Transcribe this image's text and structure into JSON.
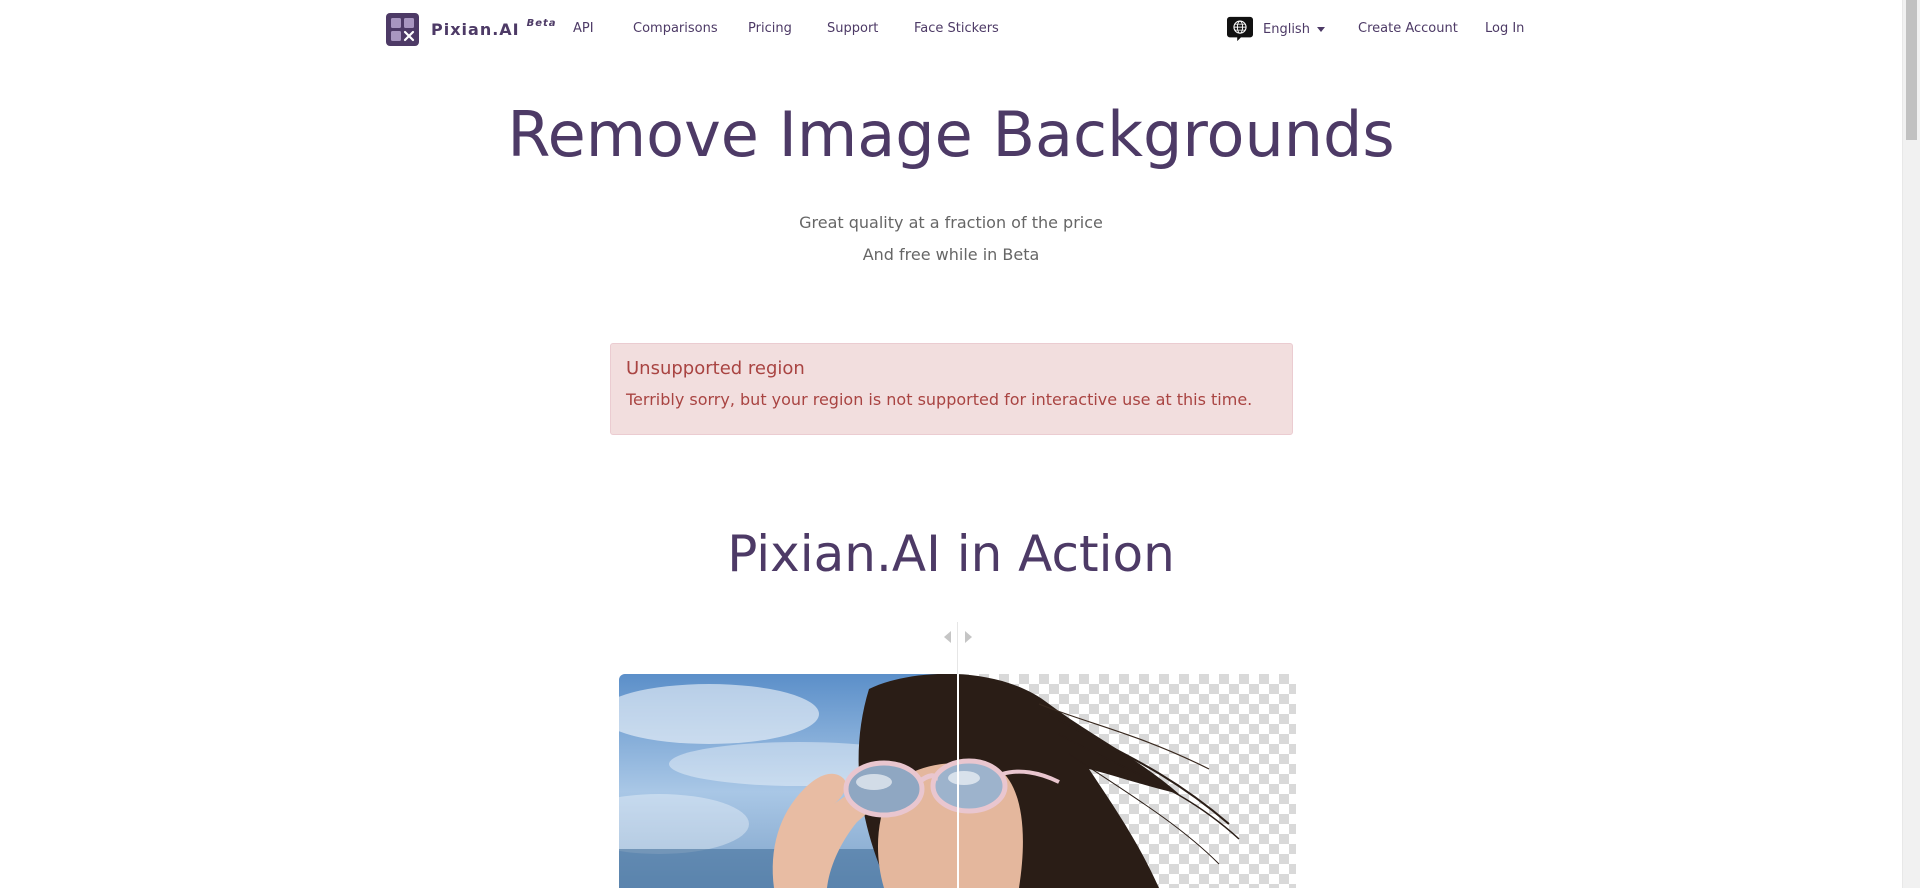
{
  "nav": {
    "brand": "Pixian.AI",
    "beta": "Beta",
    "links": [
      "API",
      "Comparisons",
      "Pricing",
      "Support",
      "Face Stickers"
    ],
    "language": "English",
    "create_account": "Create Account",
    "log_in": "Log In"
  },
  "hero": {
    "title": "Remove Image Backgrounds",
    "subtitle_line1": "Great quality at a fraction of the price",
    "subtitle_line2": "And free while in Beta"
  },
  "alert": {
    "title": "Unsupported region",
    "message": "Terribly sorry, but your region is not supported for interactive use at this time."
  },
  "action": {
    "title": "Pixian.AI in Action",
    "split_position_percent": 50
  },
  "colors": {
    "brand": "#4d3a66",
    "alert_bg": "#f2dede",
    "alert_text": "#a94442"
  },
  "icons": [
    "logo-icon",
    "globe-icon",
    "caret-down-icon",
    "slider-left-icon",
    "slider-right-icon"
  ]
}
